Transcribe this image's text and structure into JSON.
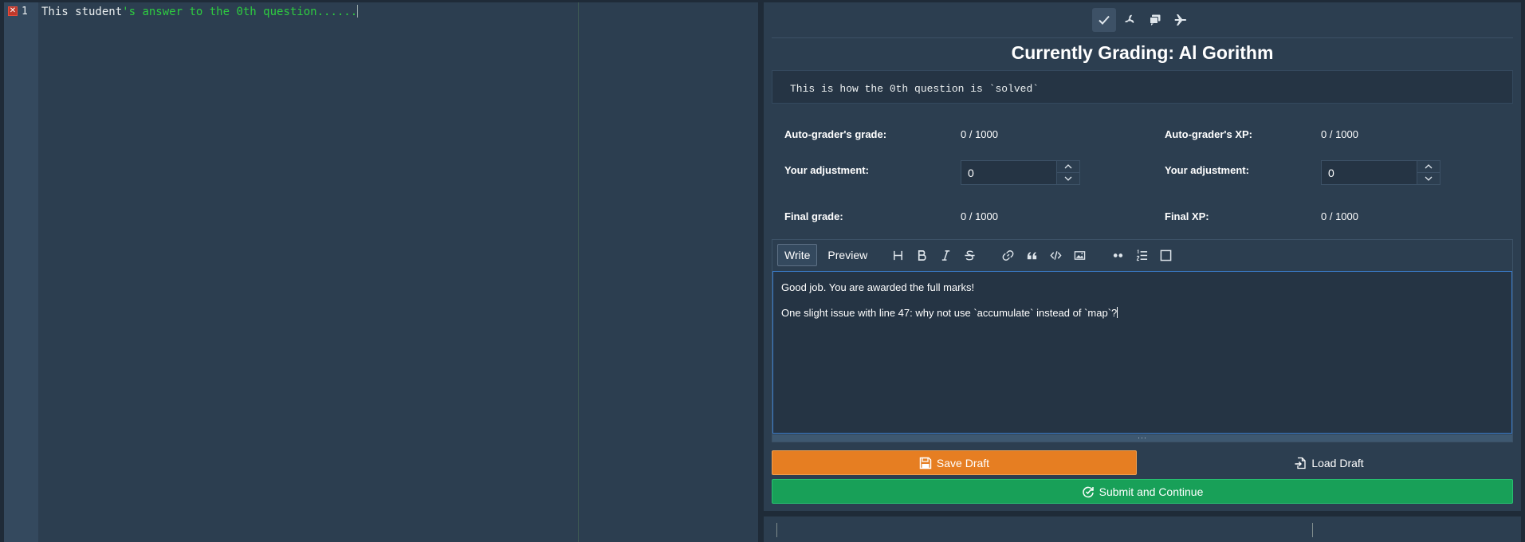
{
  "editor": {
    "line_number": "1",
    "error_marker": "✕",
    "code_plain": "This student",
    "code_string": "'s answer to the 0th question......"
  },
  "toolbar_top": {
    "icons": [
      "check-icon",
      "fan-icon",
      "comments-icon",
      "plane-icon"
    ],
    "active": "check-icon"
  },
  "title": "Currently Grading: Al Gorithm",
  "solution_text": "This is how the 0th question is `solved`",
  "grades": {
    "auto_grade_label": "Auto-grader's grade:",
    "auto_grade_value": "0 / 1000",
    "auto_xp_label": "Auto-grader's XP:",
    "auto_xp_value": "0 / 1000",
    "adjust_grade_label": "Your adjustment:",
    "adjust_grade_value": "0",
    "adjust_xp_label": "Your adjustment:",
    "adjust_xp_value": "0",
    "final_grade_label": "Final grade:",
    "final_grade_value": "0 / 1000",
    "final_xp_label": "Final XP:",
    "final_xp_value": "0 / 1000"
  },
  "md_editor": {
    "tab_write": "Write",
    "tab_preview": "Preview",
    "active_tab": "Write",
    "toolbar_icons": [
      "heading-icon",
      "bold-icon",
      "italic-icon",
      "strikethrough-icon",
      "link-icon",
      "quote-icon",
      "code-icon",
      "image-icon",
      "unordered-list-icon",
      "ordered-list-icon",
      "checkbox-icon"
    ],
    "content_line_1": "Good job. You are awarded the full marks!",
    "content_line_2": "One slight issue with line 47: why not use `accumulate` instead of `map`?",
    "grip": "···"
  },
  "buttons": {
    "save_draft": "Save Draft",
    "load_draft": "Load Draft",
    "submit": "Submit and Continue"
  },
  "colors": {
    "background": "#1f2b38",
    "panel": "#2c3e50",
    "save": "#e67e22",
    "submit": "#18a058",
    "code_string": "#2ecc40"
  }
}
